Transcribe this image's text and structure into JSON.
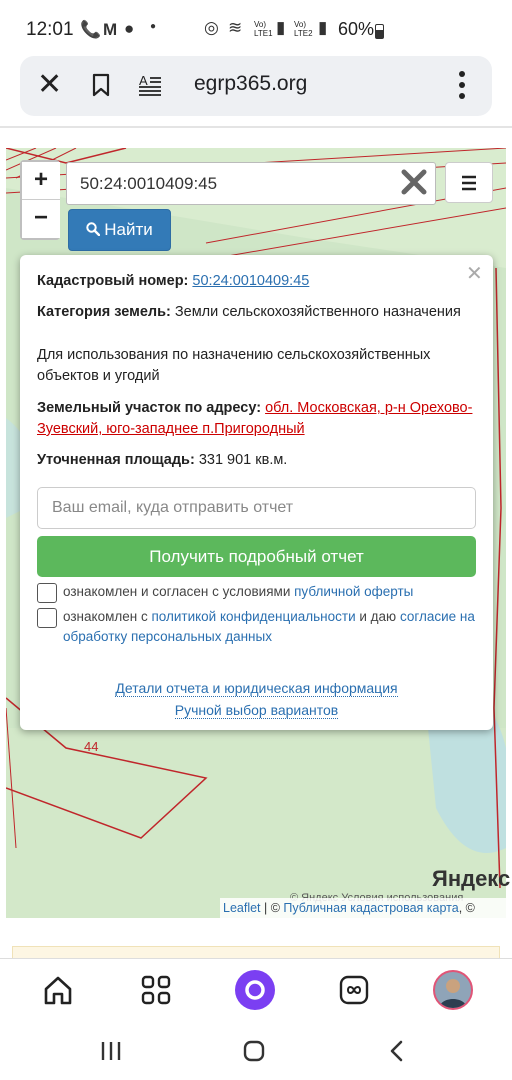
{
  "status": {
    "time": "12:01",
    "battery": "60%",
    "lte1": "Vo) LTE1",
    "lte2": "Vo) LTE2"
  },
  "browser": {
    "url": "egrp365.org"
  },
  "map": {
    "zoom_in": "+",
    "zoom_out": "−",
    "search_value": "50:24:0010409:45",
    "search_button": "Найти",
    "parcel_label": "44",
    "yandex_logo": "Яндекс",
    "yandex_terms": "© Яндекс  Условия использования",
    "attribution": {
      "leaflet": "Leaflet",
      "sep": " | © ",
      "pkk": "Публичная кадастровая карта",
      "tail": ", ©"
    }
  },
  "popup": {
    "cadastral_label": "Кадастровый номер:",
    "cadastral_value": "50:24:0010409:45",
    "category_label": "Категория земель:",
    "category_value": " Земли сельскохозяйственного назначения",
    "usage": "Для использования по назначению сельскохозяйственных объектов и угодий",
    "address_label": "Земельный участок по адресу:",
    "address_value": "обл. Московская, р-н Орехово-Зуевский, юго-западнее п.Пригородный",
    "area_label": "Уточненная площадь:",
    "area_value": " 331 901 кв.м.",
    "email_placeholder": "Ваш email, куда отправить отчет",
    "report_button": "Получить подробный отчет",
    "check1_prefix": "ознакомлен и согласен с условиями ",
    "check1_link": "публичной оферты",
    "check2_prefix": "ознакомлен с ",
    "check2_link1": "политикой конфиденциальности",
    "check2_mid": " и даю ",
    "check2_link2": "согласие на обработку персональных данных",
    "details_link": "Детали отчета и юридическая информация",
    "manual_link": "Ручной выбор вариантов"
  },
  "colors": {
    "map_green": "#cfe6c7",
    "parcel_red": "#c0262b",
    "search_blue": "#337ab7",
    "report_green": "#5cb85c",
    "alice_purple": "#7b3ff2"
  }
}
